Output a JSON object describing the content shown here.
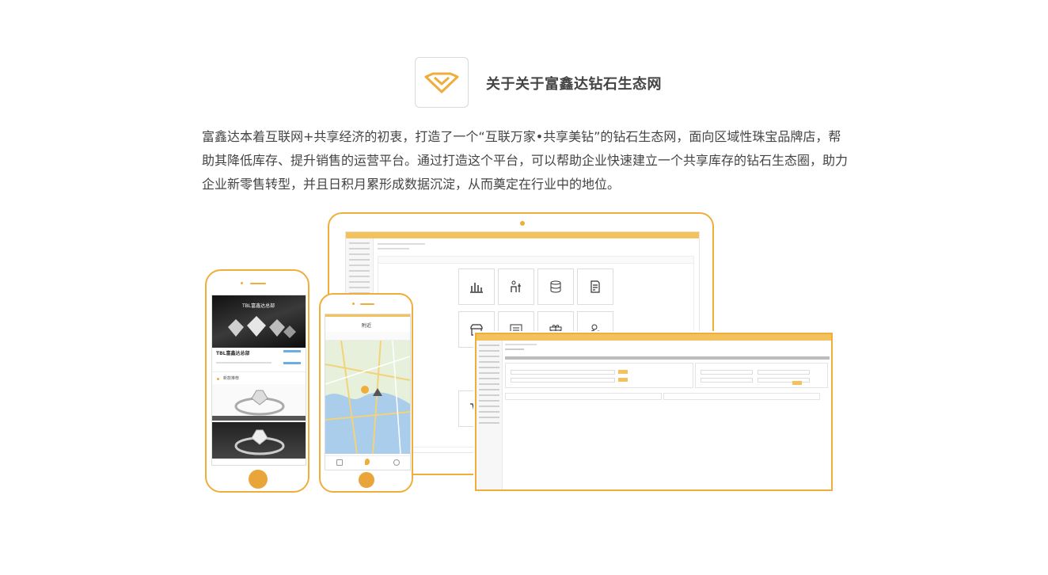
{
  "header": {
    "title": "关于关于富鑫达钻石生态网",
    "logo_icon": "diamond-logo-icon"
  },
  "intro": {
    "paragraph": "富鑫达本着互联网+共享经济的初衷，打造了一个“互联万家•共享美钻”的钻石生态网，面向区域性珠宝品牌店，帮助其降低库存、提升销售的运营平台。通过打造这个平台，可以帮助企业快速建立一个共享库存的钻石生态圈，助力企业新零售转型，并且日积月累形成数据沉淀，从而奠定在行业中的地位。"
  },
  "colors": {
    "accent": "#f0ad3c",
    "accent_fill": "#e9a53a",
    "bar": "#f4c25c",
    "text": "#444444"
  },
  "phone_left": {
    "store_name": "TBL富鑫达总部",
    "section_label": "新款推荐"
  },
  "phone_right": {
    "title": "附近"
  }
}
